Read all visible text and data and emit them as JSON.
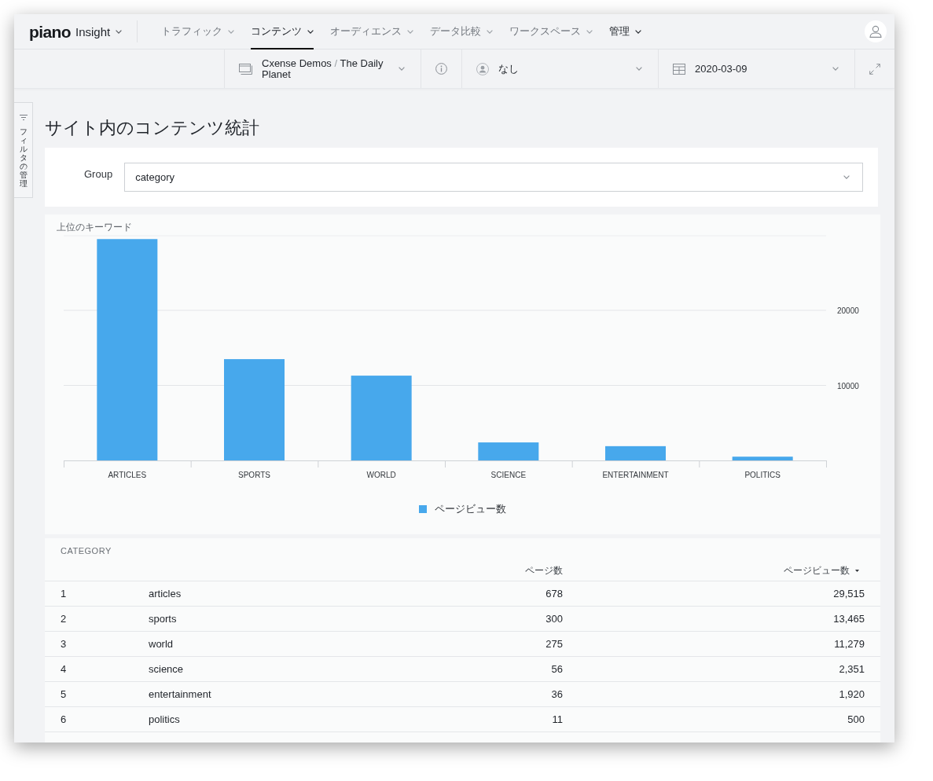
{
  "nav": {
    "logo": "piano",
    "product": "Insight",
    "items": [
      {
        "label": "トラフィック",
        "selected": false,
        "highlighted": false
      },
      {
        "label": "コンテンツ",
        "selected": true,
        "highlighted": true
      },
      {
        "label": "オーディエンス",
        "selected": false,
        "highlighted": false
      },
      {
        "label": "データ比較",
        "selected": false,
        "highlighted": false
      },
      {
        "label": "ワークスペース",
        "selected": false,
        "highlighted": false
      },
      {
        "label": "管理",
        "selected": false,
        "highlighted": true
      }
    ]
  },
  "toolbar": {
    "site": {
      "account": "Cxense Demos",
      "separator": "/",
      "name": "The Daily Planet"
    },
    "user_filter": "なし",
    "date": "2020-03-09"
  },
  "filter_panel": {
    "label": "フィルタの管理"
  },
  "page_title": "サイト内のコンテンツ統計",
  "group": {
    "label": "Group",
    "value": "category"
  },
  "chart": {
    "chart_data": {
      "type": "bar",
      "title": "上位のキーワード",
      "categories": [
        "ARTICLES",
        "SPORTS",
        "WORLD",
        "SCIENCE",
        "ENTERTAINMENT",
        "POLITICS"
      ],
      "series": [
        {
          "name": "ページビュー数",
          "color": "#47a8ec",
          "values": [
            29500,
            13500,
            11300,
            2400,
            1900,
            500
          ]
        }
      ],
      "ylim": [
        0,
        30000
      ],
      "yticks": [
        10000,
        20000
      ]
    }
  },
  "table": {
    "label": "CATEGORY",
    "columns": [
      {
        "label": "ページ数",
        "sorted": false
      },
      {
        "label": "ページビュー数",
        "sorted": true
      }
    ],
    "rows": [
      {
        "rank": "1",
        "name": "articles",
        "pages": "678",
        "views": "29,515"
      },
      {
        "rank": "2",
        "name": "sports",
        "pages": "300",
        "views": "13,465"
      },
      {
        "rank": "3",
        "name": "world",
        "pages": "275",
        "views": "11,279"
      },
      {
        "rank": "4",
        "name": "science",
        "pages": "56",
        "views": "2,351"
      },
      {
        "rank": "5",
        "name": "entertainment",
        "pages": "36",
        "views": "1,920"
      },
      {
        "rank": "6",
        "name": "politics",
        "pages": "11",
        "views": "500"
      }
    ]
  }
}
